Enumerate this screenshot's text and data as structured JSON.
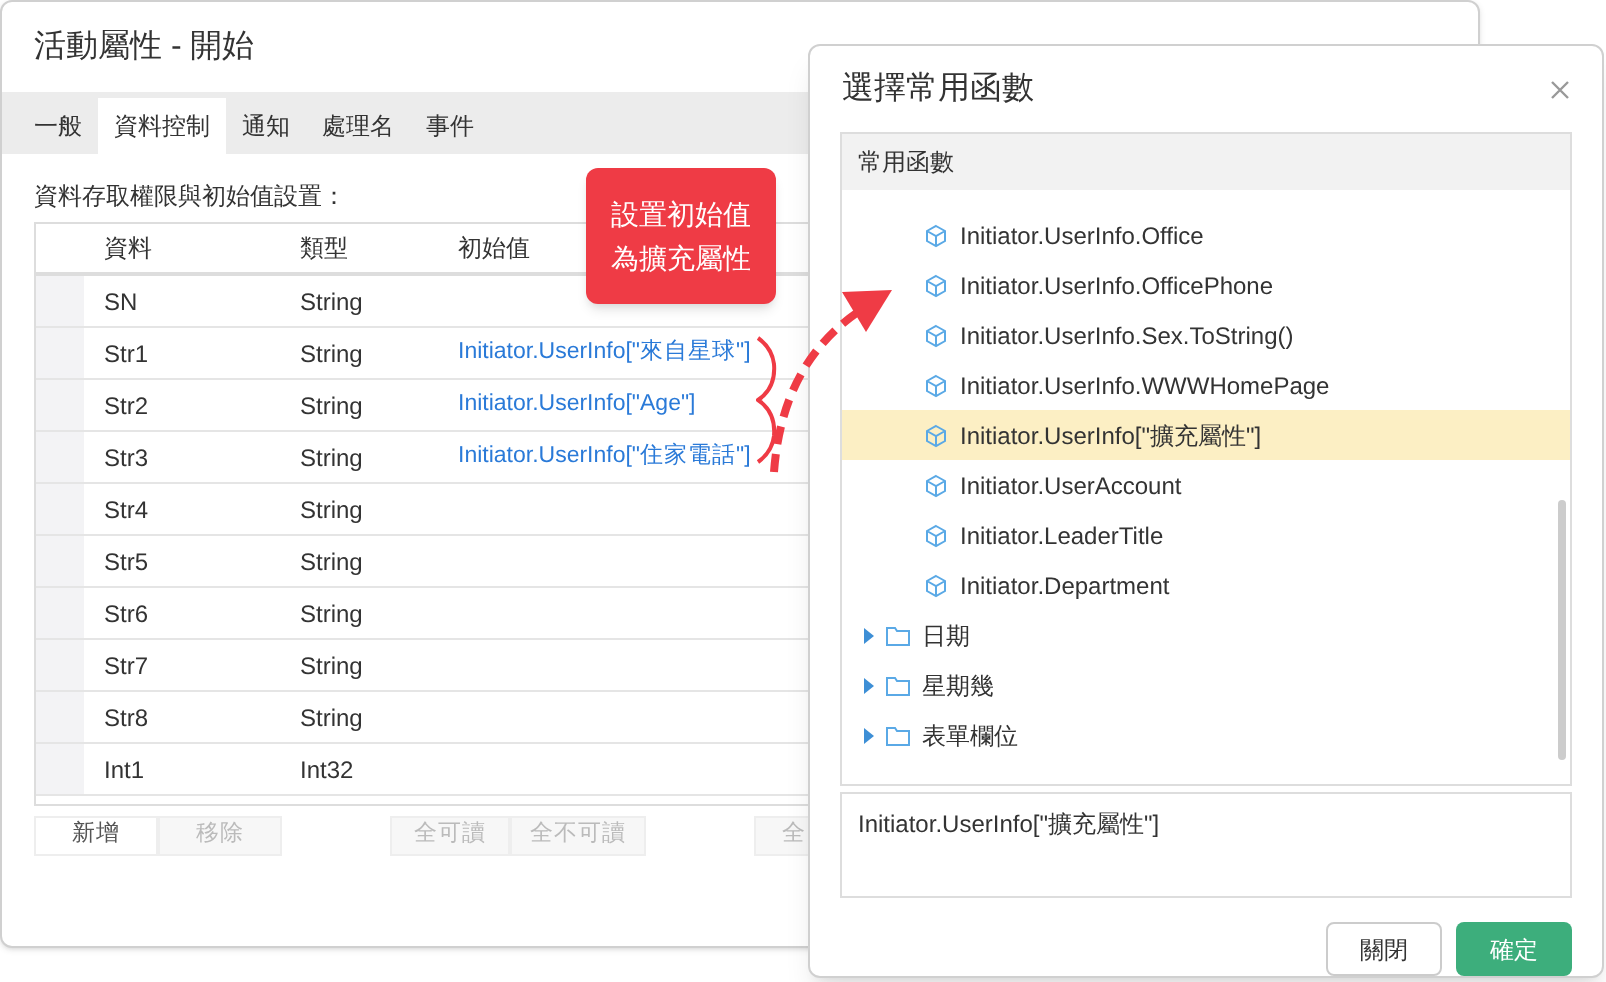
{
  "main_dialog": {
    "title": "活動屬性 - 開始",
    "tabs": [
      {
        "label": "一般",
        "selected": false
      },
      {
        "label": "資料控制",
        "selected": true
      },
      {
        "label": "通知",
        "selected": false
      },
      {
        "label": "處理名",
        "selected": false
      },
      {
        "label": "事件",
        "selected": false
      }
    ],
    "section_label": "資料存取權限與初始值設置：",
    "table": {
      "columns": [
        "資料",
        "類型",
        "初始值"
      ],
      "rows": [
        [
          "SN",
          "String",
          ""
        ],
        [
          "Str1",
          "String",
          "Initiator.UserInfo[\"來自星球\"]"
        ],
        [
          "Str2",
          "String",
          "Initiator.UserInfo[\"Age\"]"
        ],
        [
          "Str3",
          "String",
          "Initiator.UserInfo[\"住家電話\"]"
        ],
        [
          "Str4",
          "String",
          ""
        ],
        [
          "Str5",
          "String",
          ""
        ],
        [
          "Str6",
          "String",
          ""
        ],
        [
          "Str7",
          "String",
          ""
        ],
        [
          "Str8",
          "String",
          ""
        ],
        [
          "Int1",
          "Int32",
          ""
        ]
      ]
    },
    "buttons": [
      {
        "label": "新增",
        "disabled": false
      },
      {
        "label": "移除",
        "disabled": true
      },
      {
        "label": "全可讀",
        "disabled": true
      },
      {
        "label": "全不可讀",
        "disabled": true
      },
      {
        "label": "全",
        "disabled": true
      }
    ]
  },
  "callout": {
    "lines": [
      "設置初始值",
      "為擴充屬性"
    ]
  },
  "function_dialog": {
    "title": "選擇常用函數",
    "tree_header": "常用函數",
    "items": [
      {
        "kind": "function",
        "label": "Initiator.UserInfo.Office",
        "selected": false
      },
      {
        "kind": "function",
        "label": "Initiator.UserInfo.OfficePhone",
        "selected": false
      },
      {
        "kind": "function",
        "label": "Initiator.UserInfo.Sex.ToString()",
        "selected": false
      },
      {
        "kind": "function",
        "label": "Initiator.UserInfo.WWWHomePage",
        "selected": false
      },
      {
        "kind": "function",
        "label": "Initiator.UserInfo[\"擴充屬性\"]",
        "selected": true
      },
      {
        "kind": "function",
        "label": "Initiator.UserAccount",
        "selected": false
      },
      {
        "kind": "function",
        "label": "Initiator.LeaderTitle",
        "selected": false
      },
      {
        "kind": "function",
        "label": "Initiator.Department",
        "selected": false
      },
      {
        "kind": "folder",
        "label": "日期",
        "selected": false
      },
      {
        "kind": "folder",
        "label": "星期幾",
        "selected": false
      },
      {
        "kind": "folder",
        "label": "表單欄位",
        "selected": false
      }
    ],
    "expression": "Initiator.UserInfo[\"擴充屬性\"]",
    "buttons": [
      {
        "label": "關閉",
        "primary": false
      },
      {
        "label": "確定",
        "primary": true
      }
    ]
  }
}
